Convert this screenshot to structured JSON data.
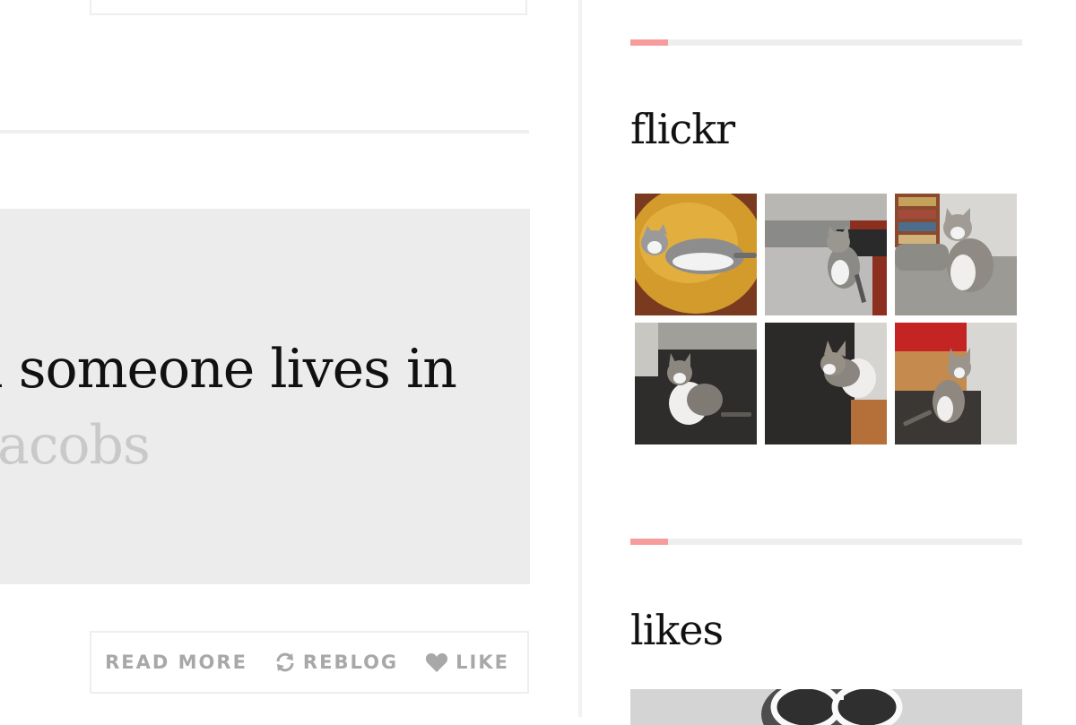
{
  "post": {
    "quote_line1": "n someone lives in",
    "quote_line2": "Jacobs"
  },
  "actions": {
    "read_more": "READ MORE",
    "reblog": "REBLOG",
    "like": "LIKE"
  },
  "sidebar": {
    "flickr_title": "flickr",
    "likes_title": "likes",
    "accent_color": "#f79c9c"
  },
  "flickr_photos": [
    {
      "subject": "kitten lying on yellow cushion"
    },
    {
      "subject": "kitten sitting on grey armchair"
    },
    {
      "subject": "kitten on sofa near bookshelf"
    },
    {
      "subject": "kitten sitting on dark rug"
    },
    {
      "subject": "kitten looking up on dark rug"
    },
    {
      "subject": "kitten by red wall on rug"
    }
  ],
  "icons": {
    "reblog": "reblog-icon",
    "like": "heart-icon"
  }
}
